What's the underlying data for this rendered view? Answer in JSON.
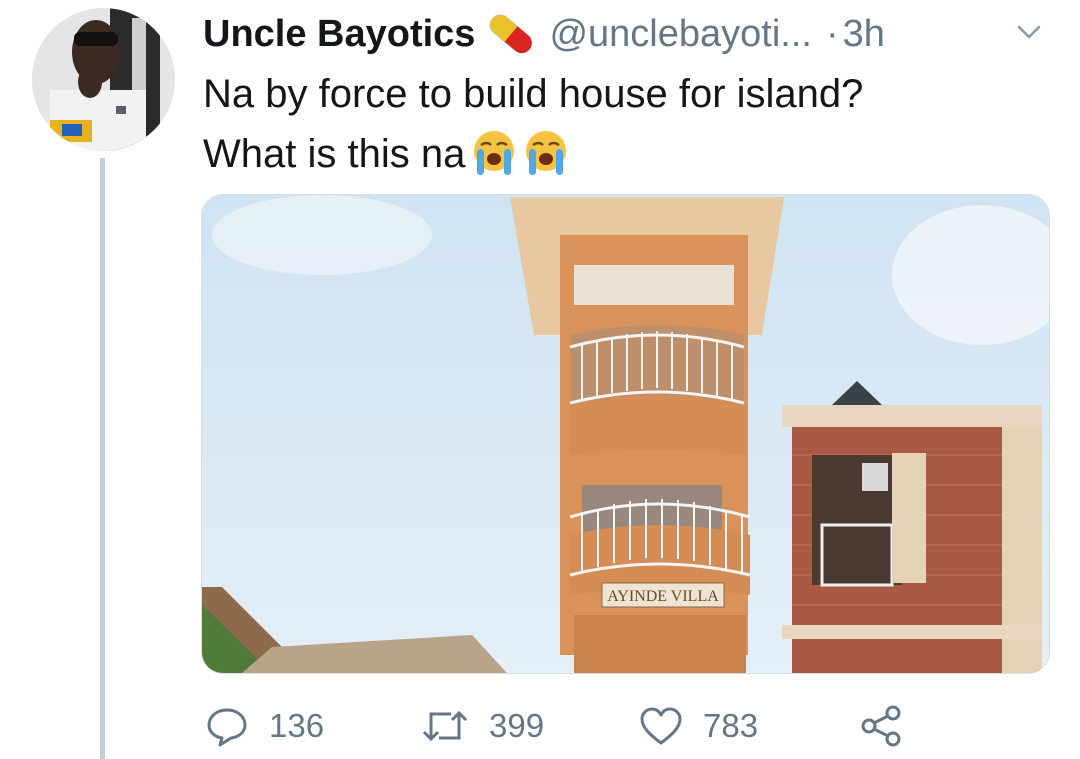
{
  "tweet": {
    "author": {
      "name": "Uncle Bayotics",
      "handle": "@unclebayoti...",
      "badge_icon": "pill-emoji-icon"
    },
    "separator": "·",
    "time": "3h",
    "text_line1": "Na by force to build house for island?",
    "text_line2": "What is this na",
    "text_emojis": [
      "loudly-crying-face-icon",
      "loudly-crying-face-icon"
    ],
    "media": {
      "sign_text": "AYINDE VILLA"
    },
    "actions": {
      "replies": "136",
      "retweets": "399",
      "likes": "783"
    }
  },
  "colors": {
    "text": "#14171a",
    "secondary": "#657786",
    "thread_line": "#c4cfd6"
  }
}
